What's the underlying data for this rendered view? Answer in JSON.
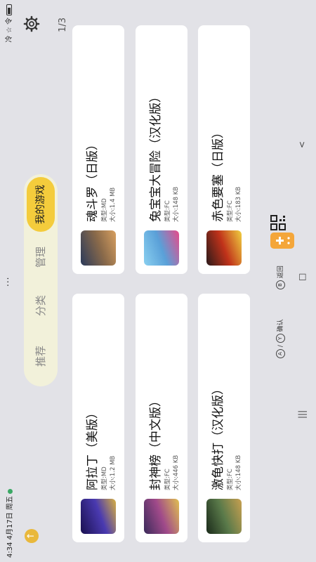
{
  "status": {
    "time_date": "4:34  4月17日 周五",
    "menu_dots": "...",
    "right": "冷 ☆ 令"
  },
  "tabs": [
    "推荐",
    "分类",
    "管理",
    "我的游戏"
  ],
  "page_indicator": "1/3",
  "games": [
    {
      "title": "阿拉丁（美版）",
      "type": "类型:MD",
      "size": "大小:1.2 MB",
      "cover_color": "#3a3290"
    },
    {
      "title": "魂斗罗（日版）",
      "type": "类型:MD",
      "size": "大小:1.4 MB",
      "cover_color": "#6a4a3a"
    },
    {
      "title": "封神榜（中文版）",
      "type": "类型:FC",
      "size": "大小:446 KB",
      "cover_color": "#4a3a6a"
    },
    {
      "title": "兔宝宝大冒险（汉化版）",
      "type": "类型:FC",
      "size": "大小:148 KB",
      "cover_color": "#6ab0d8"
    },
    {
      "title": "激龟快打（汉化版）",
      "type": "类型:FC",
      "size": "大小:148 KB",
      "cover_color": "#2a3a2a"
    },
    {
      "title": "赤色要塞（日版）",
      "type": "类型:FC",
      "size": "大小:183 KB",
      "cover_color": "#b02a1a"
    }
  ],
  "hints": {
    "confirm_keys": "A / Y",
    "confirm": "确认",
    "back_key": "B",
    "back": "返回"
  },
  "nav": {
    "recent": "|||",
    "home": "□",
    "back": "<"
  },
  "colors": {
    "accent": "#f4cc3c",
    "tab_bar": "#f2f1da",
    "background": "#e2e2e7",
    "gamepad": "#f4a63a"
  }
}
